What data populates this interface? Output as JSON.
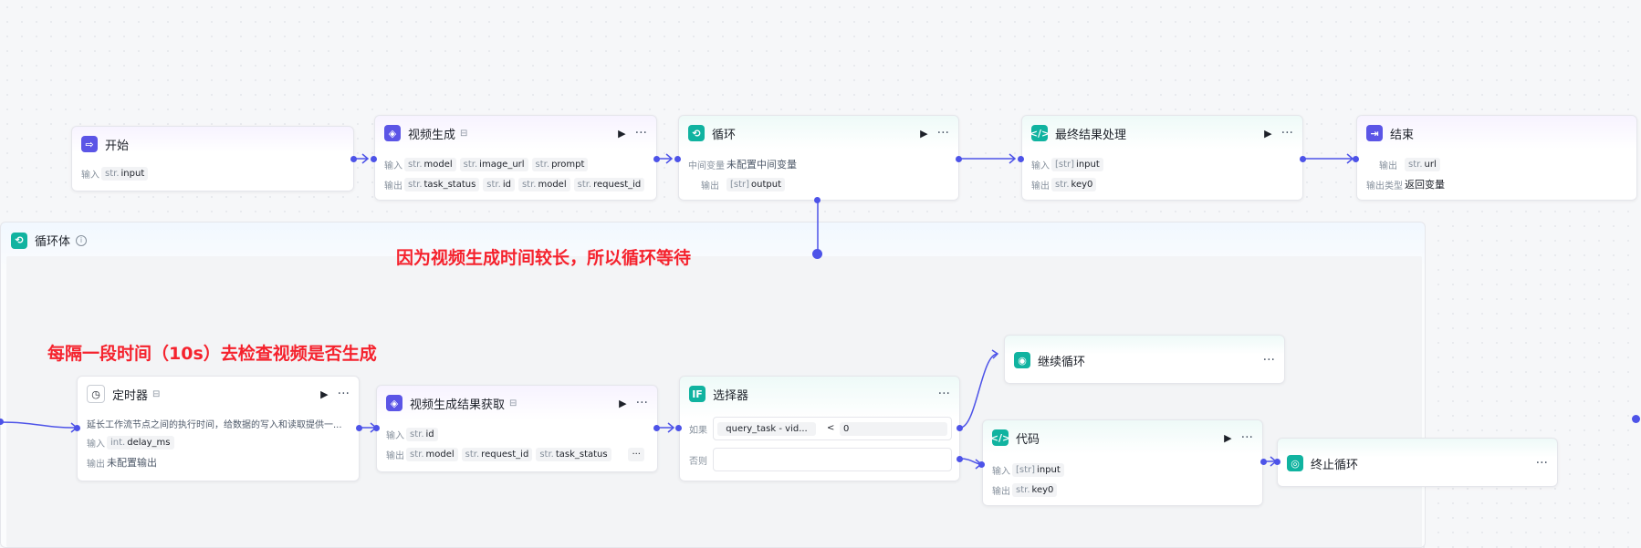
{
  "annotations": {
    "loop_reason": "因为视频生成时间较长，所以循环等待",
    "interval_note": "每隔一段时间（10s）去检查视频是否生成"
  },
  "nodes": {
    "start": {
      "title": "开始",
      "input_label": "输入",
      "input": {
        "type": "str.",
        "name": "input"
      }
    },
    "video_gen": {
      "title": "视频生成",
      "input_label": "输入",
      "output_label": "输出",
      "inputs": [
        {
          "type": "str.",
          "name": "model"
        },
        {
          "type": "str.",
          "name": "image_url"
        },
        {
          "type": "str.",
          "name": "prompt"
        }
      ],
      "outputs": [
        {
          "type": "str.",
          "name": "task_status"
        },
        {
          "type": "str.",
          "name": "id"
        },
        {
          "type": "str.",
          "name": "model"
        },
        {
          "type": "str.",
          "name": "request_id"
        }
      ]
    },
    "loop": {
      "title": "循环",
      "mid_label": "中间变量",
      "mid_value": "未配置中间变量",
      "output_label": "输出",
      "output": {
        "type": "[str]",
        "name": "output"
      }
    },
    "final": {
      "title": "最终结果处理",
      "input_label": "输入",
      "output_label": "输出",
      "input": {
        "type": "[str]",
        "name": "input"
      },
      "output": {
        "type": "str.",
        "name": "key0"
      }
    },
    "end": {
      "title": "结束",
      "output_label": "输出",
      "output": {
        "type": "str.",
        "name": "url"
      },
      "output_type_label": "输出类型",
      "output_type_value": "返回变量"
    },
    "loop_body": {
      "title": "循环体",
      "info_icon": "info-icon"
    },
    "timer": {
      "title": "定时器",
      "desc": "延长工作流节点之间的执行时间，给数据的写入和读取提供一...",
      "input_label": "输入",
      "input": {
        "type": "int.",
        "name": "delay_ms"
      },
      "output_label": "输出",
      "output_value": "未配置输出"
    },
    "video_result": {
      "title": "视频生成结果获取",
      "input_label": "输入",
      "output_label": "输出",
      "input": {
        "type": "str.",
        "name": "id"
      },
      "outputs": [
        {
          "type": "str.",
          "name": "model"
        },
        {
          "type": "str.",
          "name": "request_id"
        },
        {
          "type": "str.",
          "name": "task_status"
        }
      ],
      "more": "···"
    },
    "selector": {
      "title": "选择器",
      "if_label": "如果",
      "else_label": "否则",
      "condition_left": "query_task - vid...",
      "condition_op": "<",
      "condition_right": "0"
    },
    "continue_loop": {
      "title": "继续循环"
    },
    "code": {
      "title": "代码",
      "input_label": "输入",
      "output_label": "输出",
      "input": {
        "type": "[str]",
        "name": "input"
      },
      "output": {
        "type": "str.",
        "name": "key0"
      }
    },
    "stop_loop": {
      "title": "终止循环"
    }
  },
  "colors": {
    "accent": "#4d53e8",
    "purple_icon": "#5b55e6",
    "teal_icon": "#10b3a0",
    "annotation": "#f5222d"
  }
}
